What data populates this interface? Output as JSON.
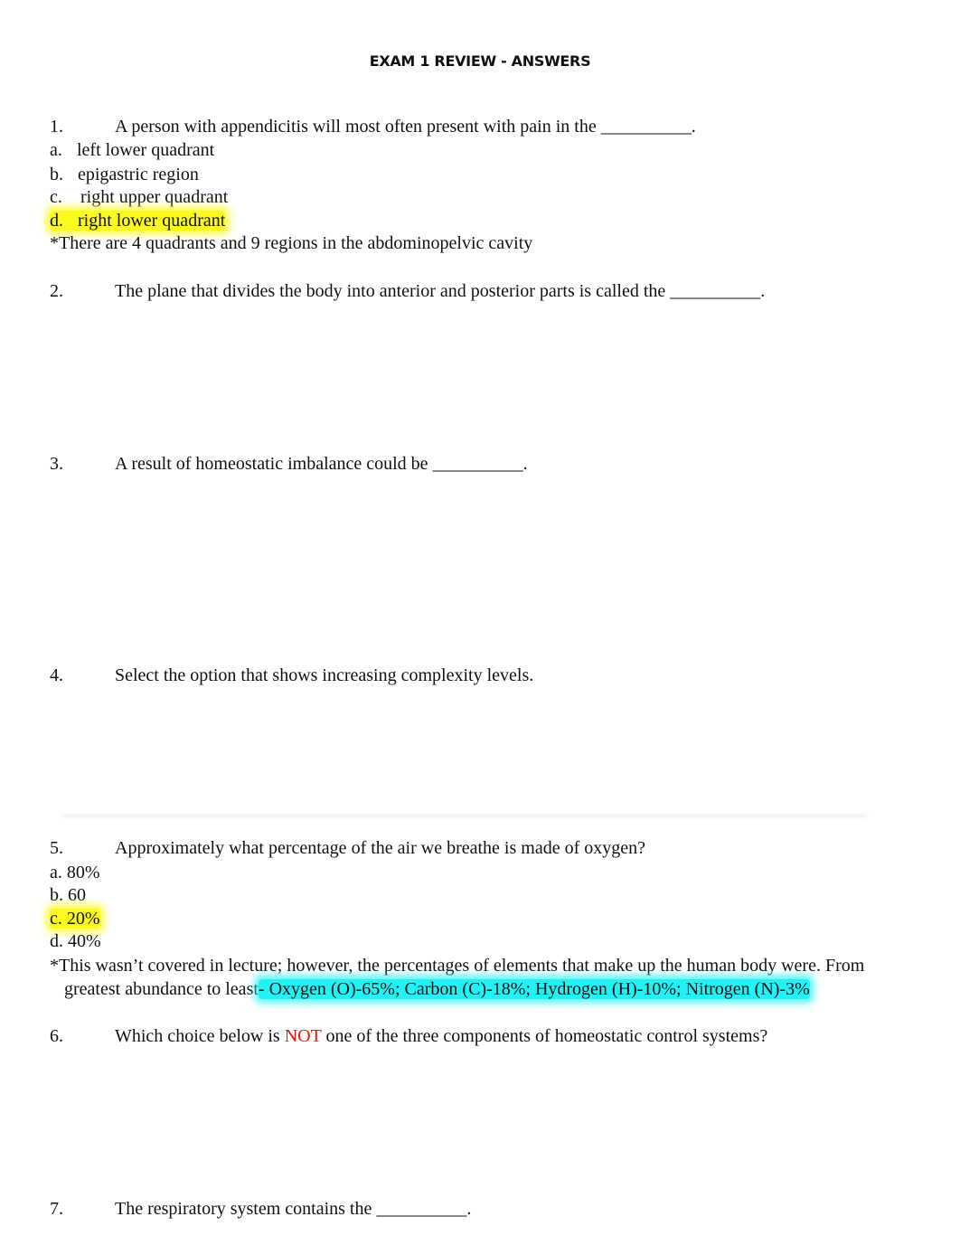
{
  "document": {
    "title": "EXAM 1 REVIEW - ANSWERS",
    "highlight_colors": {
      "answer": "#fbf91d",
      "note": "#22f1f5",
      "emphasis_text": "#ee1111"
    },
    "questions": [
      {
        "number": "1.",
        "text": "A person with appendicitis will most often present with pain in the __________.",
        "options": [
          {
            "label": "a.",
            "text": "left lower quadrant",
            "correct": false
          },
          {
            "label": "b.",
            "text": "epigastric region",
            "correct": false
          },
          {
            "label": "c.",
            "text": "right upper quadrant",
            "correct": false
          },
          {
            "label": "d.",
            "text": "right lower quadrant",
            "correct": true
          }
        ],
        "note": "*There are 4 quadrants and 9 regions in the abdominopelvic cavity"
      },
      {
        "number": "2.",
        "text": "The plane that divides the body into anterior and posterior parts is called the __________."
      },
      {
        "number": "3.",
        "text": "A result of homeostatic imbalance could be __________."
      },
      {
        "number": "4.",
        "text": "Select the option that shows increasing complexity levels."
      },
      {
        "number": "5.",
        "text": "Approximately what percentage of the air we breathe is made of oxygen?",
        "options": [
          {
            "label": "a.",
            "text": "80%",
            "correct": false
          },
          {
            "label": "b.",
            "text": "60",
            "correct": false
          },
          {
            "label": "c.",
            "text": "20%",
            "correct": true
          },
          {
            "label": "d.",
            "text": "40%",
            "correct": false
          }
        ],
        "note_line1": "*This wasn’t covered in lecture; however, the percentages of elements that make up the human body were. From",
        "note_line2_plain": "greatest abundance to least",
        "note_line2_highlight": "- Oxygen (O)-65%; Carbon (C)-18%; Hydrogen (H)-10%; Nitrogen (N)-3%"
      },
      {
        "number": "6.",
        "text_before": "Which choice below is ",
        "text_emphasis": "NOT",
        "text_after": " one of the three components of homeostatic control systems?"
      },
      {
        "number": "7.",
        "text": "The respiratory system contains the __________."
      }
    ]
  }
}
